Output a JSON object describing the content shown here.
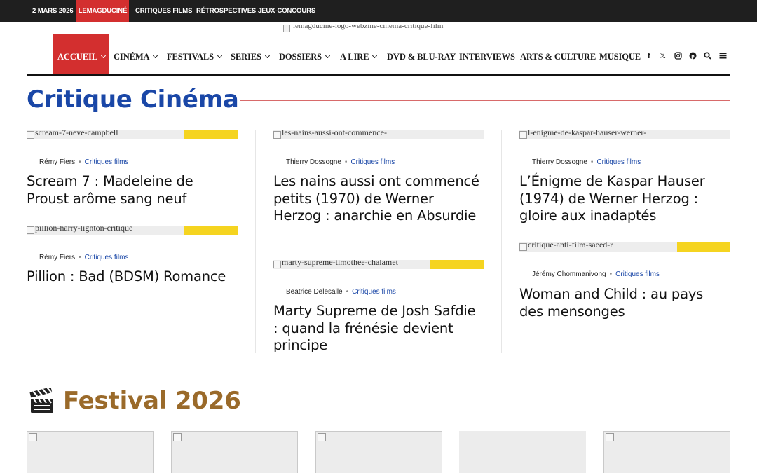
{
  "topbar": {
    "date": "2 MARS 2026",
    "items": [
      "LEMAGDUCINÉ",
      "CRITIQUES FILMS",
      "RÉTROSPECTIVES",
      "JEUX-CONCOURS"
    ]
  },
  "logo": {
    "alt": "lemagducine-logo-webzine-cinema-critique-film"
  },
  "nav": {
    "items": [
      "ACCUEIL",
      "CINÉMA",
      "FESTIVALS",
      "SERIES",
      "DOSSIERS",
      "A LIRE",
      "DVD & BLU-RAY",
      "INTERVIEWS",
      "ARTS & CULTURE",
      "MUSIQUE"
    ],
    "icons": [
      "facebook-icon",
      "x-icon",
      "instagram-icon",
      "pinterest-icon",
      "search-icon",
      "menu-icon"
    ]
  },
  "sections": {
    "critique_title": "Critique Cinéma",
    "festival_title": "Festival 2026"
  },
  "articles": [
    {
      "image_alt": "scream-7-neve-campbell",
      "author": "Rémy Fiers",
      "category": "Critiques films",
      "title": "Scream 7 : Madeleine de Proust arôme sang neuf"
    },
    {
      "image_alt": "pillion-harry-lighton-critique",
      "author": "Rémy Fiers",
      "category": "Critiques films",
      "title": "Pillion : Bad (BDSM) Romance"
    },
    {
      "image_alt": "les-nains-aussi-ont-commence-",
      "author": "Thierry Dossogne",
      "category": "Critiques films",
      "title": "Les nains aussi ont commencé petits (1970) de Werner Herzog : anarchie en Absurdie"
    },
    {
      "image_alt": "marty-supreme-timothee-chalamet",
      "author": "Beatrice Delesalle",
      "category": "Critiques films",
      "title": "Marty Supreme de Josh Safdie : quand la frénésie devient principe"
    },
    {
      "image_alt": "l-enigme-de-kaspar-hauser-werner-",
      "author": "Thierry Dossogne",
      "category": "Critiques films",
      "title": "L’Énigme de Kaspar Hauser (1974) de Werner Herzog : gloire aux inadaptés"
    },
    {
      "image_alt": "critique-anti-film-saeed-r",
      "author": "Jérémy Chommanivong",
      "category": "Critiques films",
      "title": "Woman and Child : au pays des mensonges"
    }
  ],
  "festival": {
    "thumb_count": 5
  },
  "colors": {
    "topbar_bg": "#1f1f1f",
    "accent_red": "#d32f2f",
    "link_blue": "#1a47a7",
    "festival_brown": "#9a6a2a",
    "tag_yellow": "#f5d420"
  }
}
